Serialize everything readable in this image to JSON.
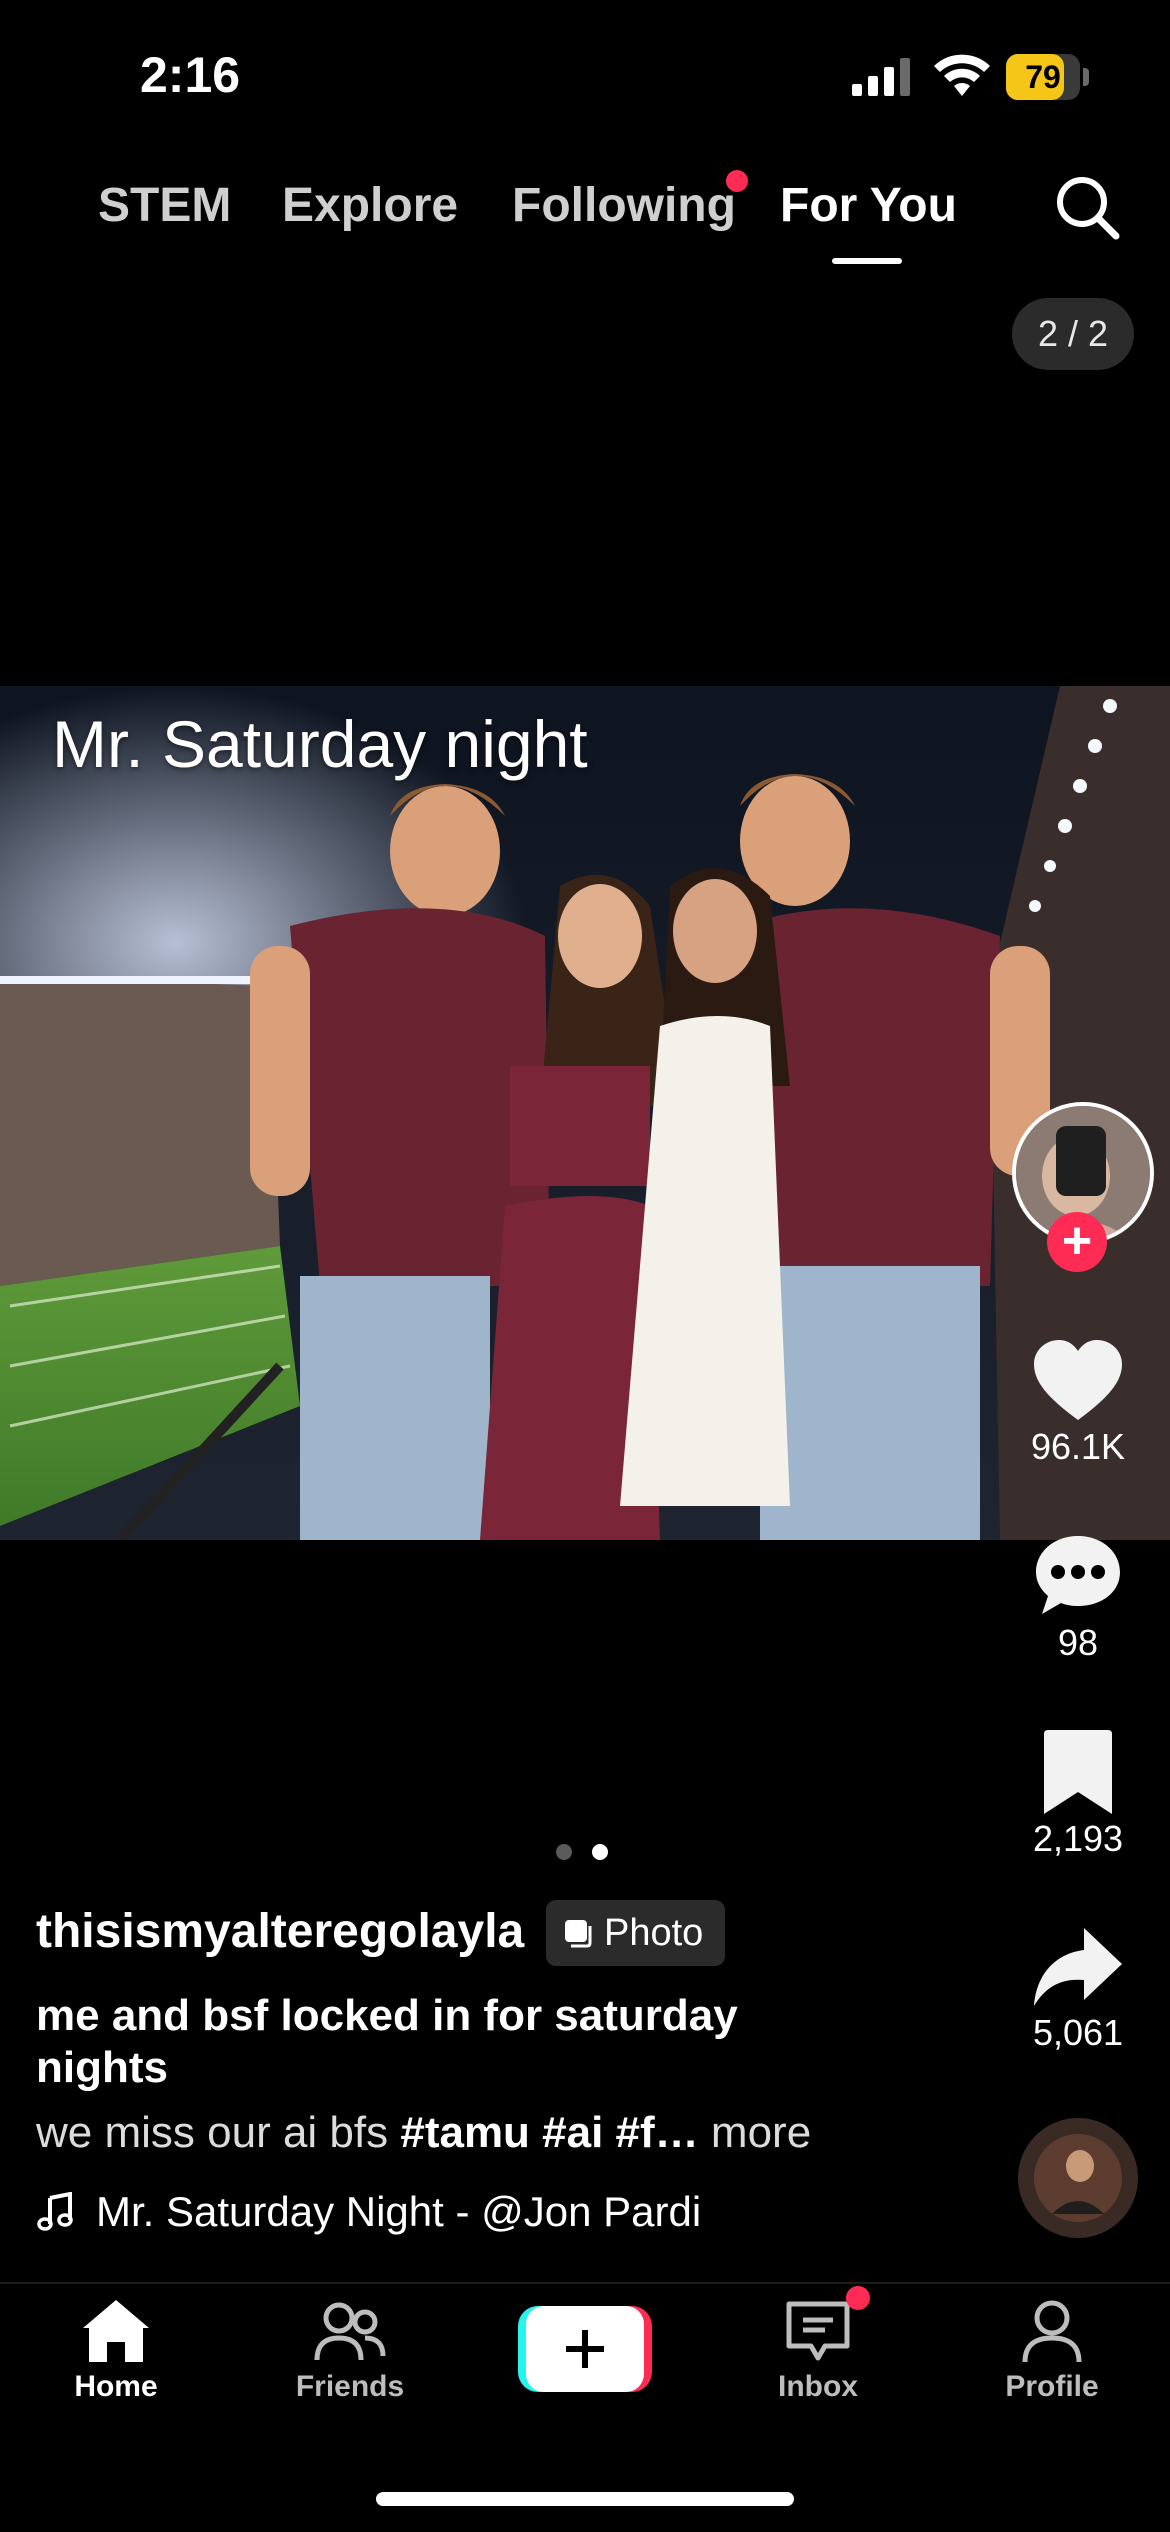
{
  "status_bar": {
    "time": "2:16",
    "battery_level": "79",
    "battery_fraction": 0.79
  },
  "tabs": [
    {
      "label": "STEM"
    },
    {
      "label": "Explore"
    },
    {
      "label": "Following"
    },
    {
      "label": "For You"
    }
  ],
  "page_counter": "2 / 2",
  "post": {
    "caption_overlay": "Mr. Saturday night",
    "username": "thisismyalteregolayla",
    "badge": "Photo",
    "title": "me and bsf locked in for saturday nights",
    "description": "we miss our ai bfs ",
    "tags": "#tamu #ai #f…",
    "more": " more",
    "music": "Mr. Saturday Night - @Jon Pardi"
  },
  "actions": {
    "follow": "+",
    "likes": "96.1K",
    "comments": "98",
    "saves": "2,193",
    "shares": "5,061"
  },
  "carousel": {
    "current": 2,
    "total": 2
  },
  "nav": {
    "home": "Home",
    "friends": "Friends",
    "inbox": "Inbox",
    "profile": "Profile"
  },
  "colors": {
    "accent": "#fe2c55",
    "battery": "#f5c518",
    "create_left": "#25f4ee"
  }
}
